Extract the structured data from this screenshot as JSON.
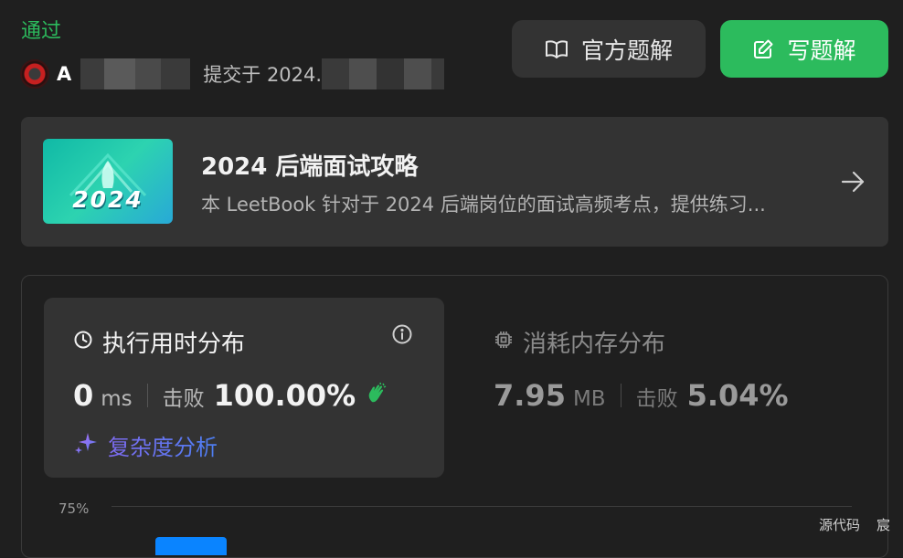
{
  "submission": {
    "status": "通过",
    "username_initial": "A",
    "submitted_label": "提交于 2024."
  },
  "actions": {
    "official_solution": "官方题解",
    "write_solution": "写题解"
  },
  "promo": {
    "thumbnail_text": "2024",
    "title": "2024 后端面试攻略",
    "description": "本 LeetBook 针对于 2024 后端岗位的面试高频考点，提供练习..."
  },
  "runtime": {
    "title": "执行用时分布",
    "value": "0",
    "unit": "ms",
    "beats_label": "击败",
    "percent": "100.00%"
  },
  "analysis": {
    "label": "复杂度分析"
  },
  "memory": {
    "title": "消耗内存分布",
    "value": "7.95",
    "unit": "MB",
    "beats_label": "击败",
    "percent": "5.04%"
  },
  "chart": {
    "y_tick": "75%"
  },
  "footer": {
    "tabs": [
      "源代码",
      "宸"
    ]
  },
  "colors": {
    "accent_green": "#2cbb5d",
    "background": "#1f1f1f",
    "card": "#333333",
    "bar_blue": "#0a84ff"
  },
  "icons": {
    "official_solution": "book-icon",
    "write_solution": "edit-icon",
    "promo_nav": "arrow-right-icon",
    "runtime": "clock-icon",
    "runtime_info": "info-icon",
    "runtime_beats": "clap-icon",
    "analysis": "sparkle-icon",
    "memory": "chip-icon"
  }
}
